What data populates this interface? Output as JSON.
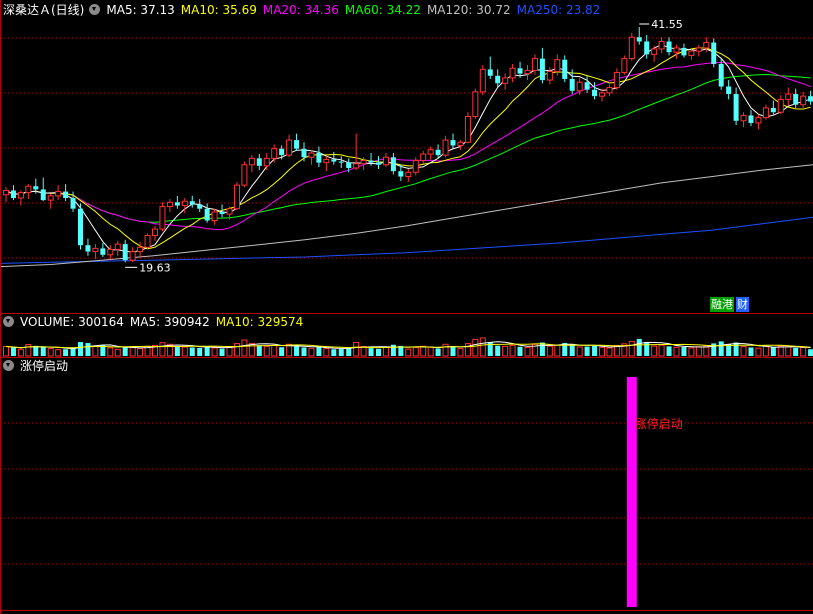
{
  "header": {
    "stock_title": "深桑达Ａ(日线)",
    "ma": [
      {
        "label": "MA5: 37.13",
        "color": "#ffffff"
      },
      {
        "label": "MA10: 35.69",
        "color": "#ffff00"
      },
      {
        "label": "MA20: 34.36",
        "color": "#ff00ff"
      },
      {
        "label": "MA60: 34.22",
        "color": "#00ff00"
      },
      {
        "label": "MA120: 30.72",
        "color": "#c0c0c0"
      },
      {
        "label": "MA250: 23.82",
        "color": "#1e50ff"
      }
    ]
  },
  "volume_header": {
    "volume": "VOLUME: 300164",
    "ma5": "MA5: 390942",
    "ma10": "MA10: 329574"
  },
  "indicator_header": {
    "title": "涨停启动"
  },
  "indicator_signal_label": "涨停启动",
  "price_annotations": {
    "high": "41.55",
    "low": "19.63"
  },
  "tags": {
    "left": "融港",
    "right": "财"
  },
  "colors": {
    "up": "#ff3232",
    "down": "#54ffff",
    "bg": "#000000",
    "grid": "#b40000",
    "signal": "#ff00ff"
  },
  "chart_data": [
    {
      "type": "candlestick",
      "title": "深桑达Ａ(日线)",
      "series_note": "approximate OHLC read from the chart",
      "ohlc": [
        [
          25.9,
          26.6,
          25.2,
          26.3
        ],
        [
          26.3,
          26.8,
          25.4,
          25.6
        ],
        [
          25.6,
          26.3,
          24.9,
          26.1
        ],
        [
          26.1,
          26.9,
          25.5,
          26.7
        ],
        [
          26.7,
          27.4,
          26.0,
          26.4
        ],
        [
          26.4,
          27.5,
          25.3,
          25.4
        ],
        [
          25.4,
          26.0,
          24.6,
          25.8
        ],
        [
          25.8,
          26.8,
          25.4,
          26.2
        ],
        [
          26.2,
          26.9,
          25.3,
          25.6
        ],
        [
          25.6,
          26.2,
          24.3,
          24.6
        ],
        [
          24.6,
          25.1,
          20.8,
          21.2
        ],
        [
          21.2,
          21.8,
          20.2,
          20.6
        ],
        [
          20.6,
          21.3,
          19.9,
          20.9
        ],
        [
          20.9,
          21.4,
          20.1,
          20.3
        ],
        [
          20.3,
          21.2,
          19.9,
          20.8
        ],
        [
          20.8,
          21.6,
          20.2,
          21.3
        ],
        [
          21.3,
          21.7,
          19.6,
          19.8
        ],
        [
          19.8,
          21.0,
          19.63,
          20.6
        ],
        [
          20.6,
          21.5,
          20.1,
          21.0
        ],
        [
          21.0,
          22.3,
          20.8,
          22.1
        ],
        [
          22.1,
          23.0,
          21.6,
          22.7
        ],
        [
          22.7,
          25.2,
          22.5,
          24.8
        ],
        [
          24.8,
          25.5,
          24.3,
          25.2
        ],
        [
          25.2,
          25.8,
          24.6,
          24.9
        ],
        [
          24.9,
          25.6,
          24.2,
          25.3
        ],
        [
          25.3,
          25.8,
          24.7,
          25.0
        ],
        [
          25.0,
          25.5,
          24.3,
          24.6
        ],
        [
          24.6,
          25.1,
          23.3,
          23.5
        ],
        [
          23.5,
          24.6,
          23.1,
          24.3
        ],
        [
          24.3,
          25.0,
          23.8,
          24.1
        ],
        [
          24.1,
          24.8,
          23.6,
          24.6
        ],
        [
          24.6,
          27.1,
          24.5,
          26.8
        ],
        [
          26.8,
          29.0,
          26.6,
          28.7
        ],
        [
          28.7,
          29.6,
          28.0,
          29.3
        ],
        [
          29.3,
          29.7,
          28.2,
          28.6
        ],
        [
          28.6,
          29.8,
          28.2,
          29.3
        ],
        [
          29.3,
          30.6,
          28.9,
          30.2
        ],
        [
          30.2,
          30.5,
          29.2,
          29.6
        ],
        [
          29.6,
          31.5,
          29.4,
          31.0
        ],
        [
          31.0,
          31.6,
          30.0,
          30.2
        ],
        [
          30.2,
          30.8,
          29.0,
          29.4
        ],
        [
          29.4,
          30.1,
          28.7,
          29.8
        ],
        [
          29.8,
          30.4,
          28.5,
          28.9
        ],
        [
          28.9,
          29.5,
          28.1,
          29.2
        ],
        [
          29.2,
          29.9,
          28.7,
          29.0
        ],
        [
          29.0,
          29.5,
          28.4,
          28.9
        ],
        [
          28.9,
          29.3,
          28.0,
          28.4
        ],
        [
          28.4,
          31.6,
          28.2,
          28.8
        ],
        [
          28.8,
          29.4,
          28.2,
          29.1
        ],
        [
          29.1,
          29.8,
          28.6,
          28.9
        ],
        [
          28.9,
          29.5,
          28.3,
          28.7
        ],
        [
          28.7,
          29.8,
          28.5,
          29.4
        ],
        [
          29.4,
          29.8,
          27.8,
          28.1
        ],
        [
          28.1,
          28.7,
          27.2,
          27.6
        ],
        [
          27.6,
          28.3,
          27.1,
          28.0
        ],
        [
          28.0,
          29.4,
          27.7,
          29.1
        ],
        [
          29.1,
          30.0,
          28.8,
          29.7
        ],
        [
          29.7,
          30.4,
          29.2,
          30.1
        ],
        [
          30.1,
          30.6,
          29.3,
          29.6
        ],
        [
          29.6,
          31.4,
          29.4,
          31.0
        ],
        [
          31.0,
          31.6,
          30.2,
          30.5
        ],
        [
          30.5,
          31.0,
          30.1,
          30.8
        ],
        [
          30.8,
          33.6,
          30.7,
          33.2
        ],
        [
          33.2,
          35.8,
          33.0,
          35.5
        ],
        [
          35.5,
          38.0,
          35.2,
          37.6
        ],
        [
          37.6,
          38.8,
          36.7,
          37.0
        ],
        [
          37.0,
          37.6,
          35.9,
          36.3
        ],
        [
          36.3,
          37.2,
          35.7,
          36.8
        ],
        [
          36.8,
          38.1,
          36.4,
          37.7
        ],
        [
          37.7,
          38.3,
          36.8,
          37.2
        ],
        [
          37.2,
          38.0,
          36.6,
          37.5
        ],
        [
          37.5,
          39.0,
          37.1,
          38.6
        ],
        [
          38.6,
          39.6,
          36.3,
          36.6
        ],
        [
          36.6,
          37.8,
          36.2,
          37.4
        ],
        [
          37.4,
          39.0,
          37.0,
          38.5
        ],
        [
          38.5,
          38.9,
          36.4,
          36.7
        ],
        [
          36.7,
          37.6,
          35.3,
          35.6
        ],
        [
          35.6,
          36.8,
          35.2,
          36.4
        ],
        [
          36.4,
          37.0,
          35.4,
          35.7
        ],
        [
          35.7,
          36.4,
          34.8,
          35.1
        ],
        [
          35.1,
          35.8,
          34.6,
          35.4
        ],
        [
          35.4,
          36.2,
          35.1,
          35.9
        ],
        [
          35.9,
          37.7,
          35.7,
          37.3
        ],
        [
          37.3,
          38.9,
          37.1,
          38.6
        ],
        [
          38.6,
          41.0,
          38.4,
          40.6
        ],
        [
          40.6,
          41.55,
          39.9,
          40.2
        ],
        [
          40.2,
          40.8,
          38.6,
          39.0
        ],
        [
          39.0,
          39.8,
          38.3,
          39.5
        ],
        [
          39.5,
          40.6,
          39.1,
          40.2
        ],
        [
          40.2,
          40.6,
          38.9,
          39.2
        ],
        [
          39.2,
          39.9,
          38.6,
          39.6
        ],
        [
          39.6,
          40.0,
          38.7,
          38.9
        ],
        [
          38.9,
          39.6,
          38.5,
          39.3
        ],
        [
          39.3,
          39.9,
          38.8,
          39.6
        ],
        [
          39.6,
          40.6,
          39.2,
          40.1
        ],
        [
          40.1,
          40.5,
          37.8,
          38.1
        ],
        [
          38.1,
          38.6,
          35.7,
          36.0
        ],
        [
          36.0,
          36.6,
          34.8,
          35.3
        ],
        [
          35.3,
          35.9,
          32.4,
          32.8
        ],
        [
          32.8,
          33.6,
          32.2,
          33.3
        ],
        [
          33.3,
          33.8,
          32.3,
          32.6
        ],
        [
          32.6,
          33.4,
          32.0,
          33.1
        ],
        [
          33.1,
          34.3,
          32.9,
          34.0
        ],
        [
          34.0,
          34.7,
          33.4,
          33.6
        ],
        [
          33.6,
          35.2,
          33.4,
          34.8
        ],
        [
          34.8,
          35.9,
          34.2,
          35.3
        ],
        [
          35.3,
          35.8,
          34.0,
          34.3
        ],
        [
          34.3,
          35.5,
          34.0,
          35.1
        ],
        [
          35.1,
          35.6,
          34.3,
          34.6
        ]
      ],
      "annotations": {
        "high": 41.55,
        "low": 19.63
      },
      "ma_latest": {
        "MA5": 37.13,
        "MA10": 35.69,
        "MA20": 34.36,
        "MA60": 34.22,
        "MA120": 30.72,
        "MA250": 23.82
      },
      "ma_series": {
        "MA120": [
          19.2,
          19.4,
          19.8,
          20.2,
          20.7,
          21.2,
          21.7,
          22.3,
          23.0,
          23.8,
          24.6,
          25.4,
          26.2,
          27.0,
          27.6,
          28.2,
          28.7
        ],
        "MA250": [
          19.5,
          19.6,
          19.7,
          19.8,
          19.9,
          20.0,
          20.1,
          20.3,
          20.5,
          20.8,
          21.1,
          21.4,
          21.8,
          22.2,
          22.6,
          23.2,
          23.8
        ]
      }
    },
    {
      "type": "bar",
      "title": "VOLUME",
      "values": [
        420,
        380,
        300,
        510,
        450,
        390,
        330,
        280,
        300,
        350,
        620,
        580,
        430,
        470,
        360,
        300,
        410,
        380,
        340,
        430,
        470,
        590,
        520,
        430,
        400,
        380,
        360,
        440,
        360,
        330,
        390,
        550,
        710,
        560,
        480,
        430,
        470,
        390,
        520,
        420,
        380,
        340,
        400,
        330,
        300,
        310,
        350,
        600,
        420,
        350,
        320,
        380,
        500,
        450,
        310,
        380,
        430,
        400,
        330,
        520,
        420,
        330,
        550,
        740,
        800,
        610,
        460,
        430,
        470,
        410,
        380,
        520,
        600,
        440,
        490,
        580,
        520,
        400,
        420,
        450,
        380,
        360,
        470,
        540,
        650,
        760,
        600,
        440,
        480,
        430,
        390,
        400,
        360,
        410,
        450,
        560,
        650,
        520,
        600,
        420,
        380,
        350,
        430,
        380,
        450,
        410,
        360,
        380,
        300
      ],
      "ma": {
        "MA5": 390942,
        "MA10": 329574
      },
      "latest": 300164
    },
    {
      "type": "bar",
      "title": "涨停启动",
      "signal_index": 84,
      "signal_value": 1
    }
  ]
}
